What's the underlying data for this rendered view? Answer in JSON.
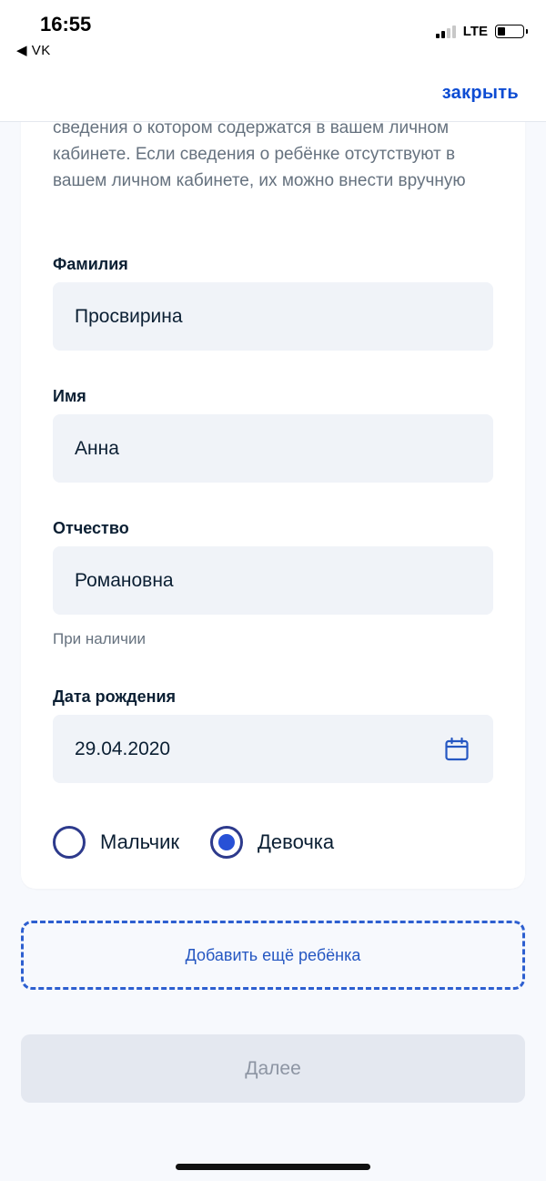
{
  "status_bar": {
    "time": "16:55",
    "back_app": "◀ VK",
    "network": "LTE"
  },
  "nav": {
    "close_label": "закрыть"
  },
  "form": {
    "intro": "сведения о котором содержатся в вашем личном кабинете. Если сведения о ребёнке отсутствуют в вашем личном кабинете, их можно внести вручную",
    "surname": {
      "label": "Фамилия",
      "value": "Просвирина"
    },
    "name": {
      "label": "Имя",
      "value": "Анна"
    },
    "patronymic": {
      "label": "Отчество",
      "value": "Романовна",
      "hint": "При наличии"
    },
    "birth_date": {
      "label": "Дата рождения",
      "value": "29.04.2020",
      "icon": "calendar-icon"
    },
    "gender": {
      "options": [
        {
          "label": "Мальчик",
          "checked": false
        },
        {
          "label": "Девочка",
          "checked": true
        }
      ]
    }
  },
  "actions": {
    "add_child_label": "Добавить ещё ребёнка",
    "next_label": "Далее"
  },
  "colors": {
    "accent": "#0d4cd3",
    "radio_fill": "#2851d6",
    "field_bg": "#f0f3f8",
    "disabled_btn_bg": "#e4e8f0"
  }
}
